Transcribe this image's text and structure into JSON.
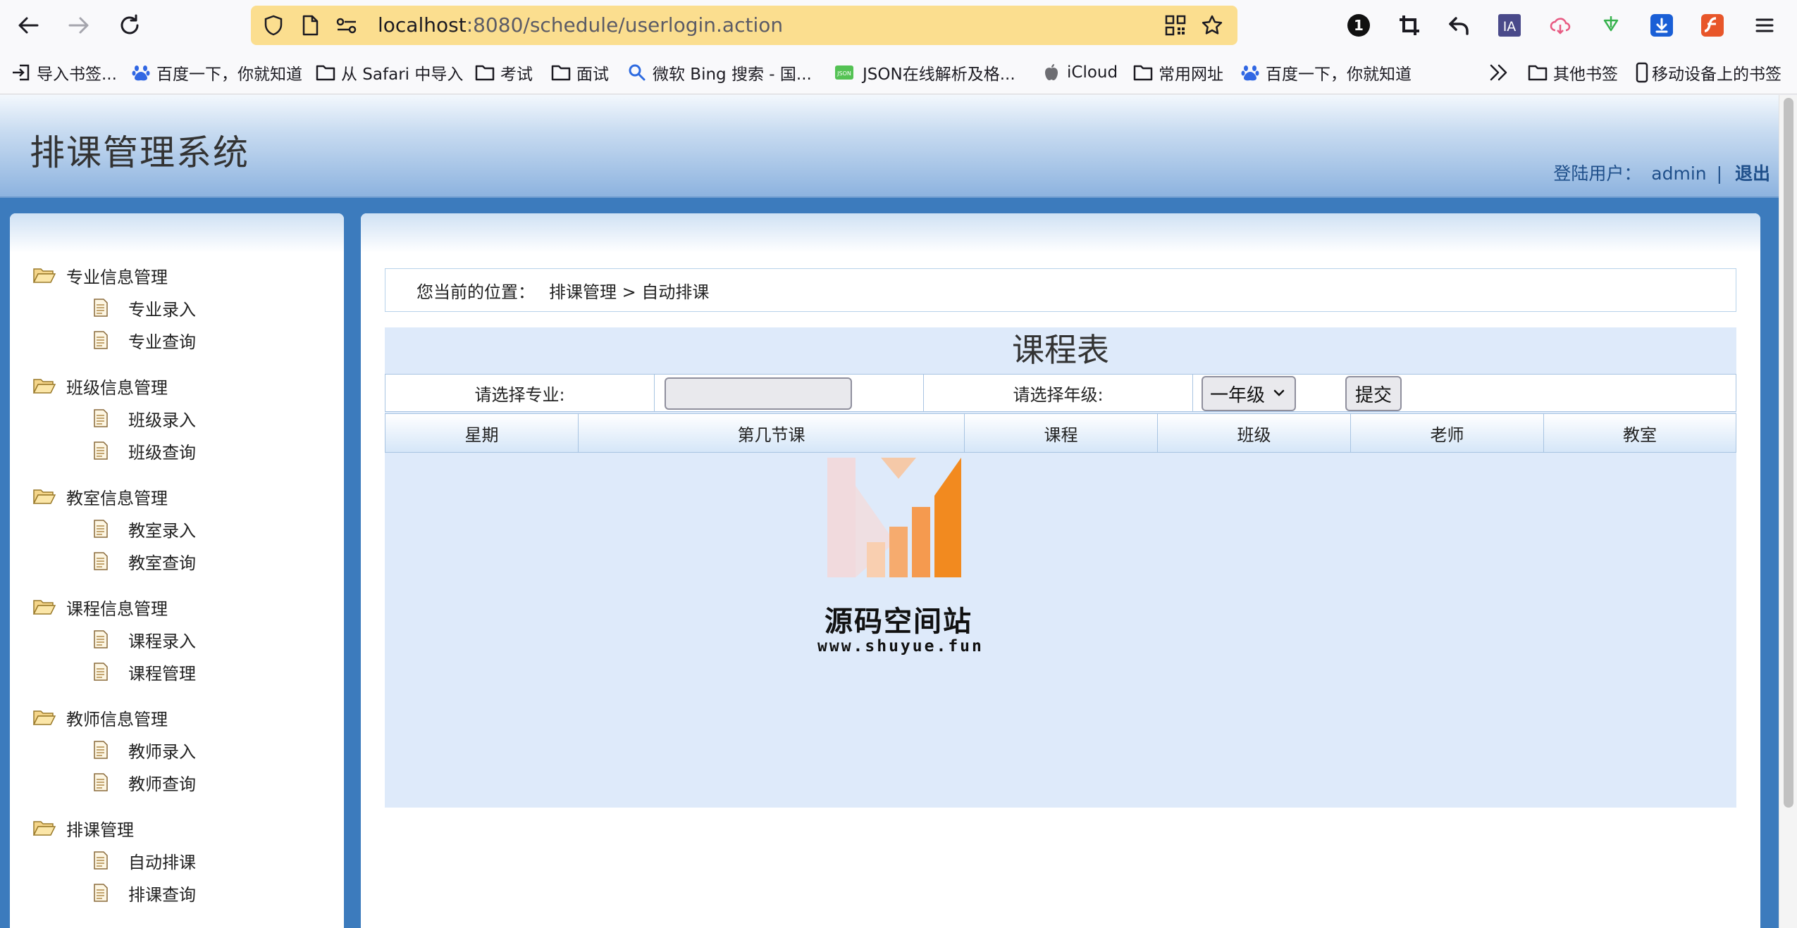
{
  "browser": {
    "url_host": "localhost",
    "url_path": ":8080/schedule/userlogin.action",
    "badge_count": "1",
    "ext_ia": "IA"
  },
  "bookmarks": [
    {
      "label": "导入书签..."
    },
    {
      "label": "百度一下，你就知道"
    },
    {
      "label": "从 Safari 中导入"
    },
    {
      "label": "考试"
    },
    {
      "label": "面试"
    },
    {
      "label": "微软 Bing 搜索 - 国..."
    },
    {
      "label": "JSON在线解析及格..."
    },
    {
      "label": "iCloud"
    },
    {
      "label": "常用网址"
    },
    {
      "label": "百度一下，你就知道"
    },
    {
      "label": "其他书签"
    },
    {
      "label": "移动设备上的书签"
    }
  ],
  "json_badge": "JSON",
  "header": {
    "title": "排课管理系统",
    "user_label": "登陆用户：",
    "username": "admin",
    "separator": "|",
    "logout": "退出"
  },
  "sidebar": {
    "groups": [
      {
        "title": "专业信息管理",
        "items": [
          "专业录入",
          "专业查询"
        ]
      },
      {
        "title": "班级信息管理",
        "items": [
          "班级录入",
          "班级查询"
        ]
      },
      {
        "title": "教室信息管理",
        "items": [
          "教室录入",
          "教室查询"
        ]
      },
      {
        "title": "课程信息管理",
        "items": [
          "课程录入",
          "课程管理"
        ]
      },
      {
        "title": "教师信息管理",
        "items": [
          "教师录入",
          "教师查询"
        ]
      },
      {
        "title": "排课管理",
        "items": [
          "自动排课",
          "排课查询"
        ]
      }
    ]
  },
  "breadcrumb": {
    "label": "您当前的位置：",
    "path": "排课管理 > 自动排课"
  },
  "schedule": {
    "title": "课程表",
    "major_label": "请选择专业:",
    "major_value": "",
    "grade_label": "请选择年级:",
    "grade_value": "一年级",
    "submit": "提交",
    "columns": [
      "星期",
      "第几节课",
      "课程",
      "班级",
      "老师",
      "教室"
    ]
  },
  "watermark": {
    "name": "源码空间站",
    "url": "www.shuyue.fun"
  }
}
